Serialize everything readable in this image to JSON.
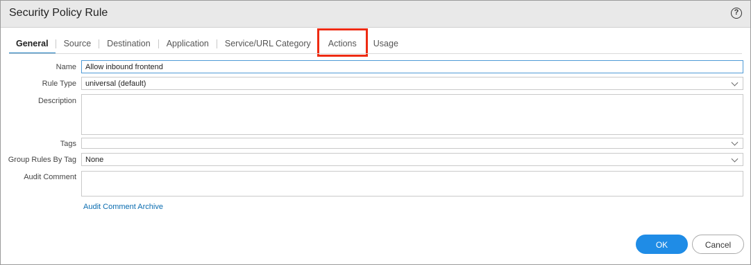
{
  "dialog": {
    "title": "Security Policy Rule",
    "help_icon": "question-circle-icon"
  },
  "tabs": [
    {
      "label": "General",
      "active": true
    },
    {
      "label": "Source"
    },
    {
      "label": "Destination"
    },
    {
      "label": "Application"
    },
    {
      "label": "Service/URL Category"
    },
    {
      "label": "Actions",
      "highlighted": true
    },
    {
      "label": "Usage"
    }
  ],
  "form": {
    "name": {
      "label": "Name",
      "value": "Allow inbound frontend"
    },
    "rule_type": {
      "label": "Rule Type",
      "value": "universal (default)"
    },
    "description": {
      "label": "Description",
      "value": ""
    },
    "tags": {
      "label": "Tags",
      "value": ""
    },
    "group_rules_by_tag": {
      "label": "Group Rules By Tag",
      "value": "None"
    },
    "audit_comment": {
      "label": "Audit Comment",
      "value": ""
    },
    "audit_archive_link": "Audit Comment Archive"
  },
  "buttons": {
    "ok": "OK",
    "cancel": "Cancel"
  },
  "colors": {
    "accent": "#1f8ce6",
    "highlight": "#ee2b12",
    "link": "#0a6cb0"
  }
}
